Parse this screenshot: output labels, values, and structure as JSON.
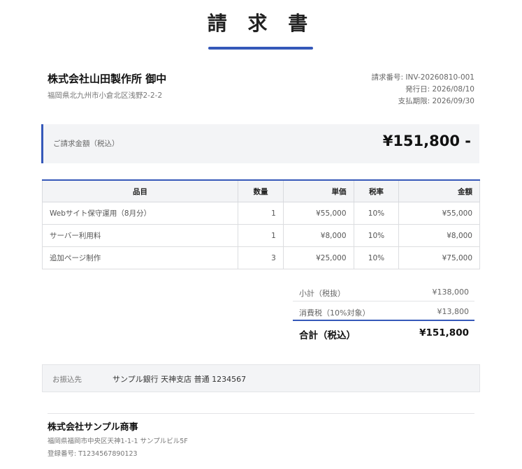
{
  "document": {
    "title": "請 求 書"
  },
  "addressee": {
    "name": "株式会社山田製作所 御中",
    "address": "福岡県北九州市小倉北区浅野2-2-2"
  },
  "meta": {
    "invoice_number": "請求番号: INV-20260810-001",
    "issue_date": "発行日: 2026/08/10",
    "due_date": "支払期限: 2026/09/30"
  },
  "banner": {
    "label": "ご請求金額（税込）",
    "amount": "¥151,800 -"
  },
  "items_table": {
    "headers": {
      "name": "品目",
      "qty": "数量",
      "unit_price": "単価",
      "tax_rate": "税率",
      "amount": "金額"
    },
    "rows": [
      {
        "name": "Webサイト保守運用（8月分）",
        "qty": "1",
        "unit_price": "¥55,000",
        "tax_rate": "10%",
        "amount": "¥55,000"
      },
      {
        "name": "サーバー利用料",
        "qty": "1",
        "unit_price": "¥8,000",
        "tax_rate": "10%",
        "amount": "¥8,000"
      },
      {
        "name": "追加ページ制作",
        "qty": "3",
        "unit_price": "¥25,000",
        "tax_rate": "10%",
        "amount": "¥75,000"
      }
    ]
  },
  "summary": {
    "subtotal_label": "小計（税抜）",
    "subtotal_value": "¥138,000",
    "tax_label": "消費税（10%対象）",
    "tax_value": "¥13,800",
    "total_label": "合計（税込）",
    "total_value": "¥151,800"
  },
  "bank": {
    "label": "お振込先",
    "value": "サンプル銀行 天神支店 普通 1234567"
  },
  "issuer": {
    "name": "株式会社サンプル商事",
    "address": "福岡県福岡市中央区天神1-1-1 サンプルビル5F",
    "registration": "登録番号: T1234567890123"
  },
  "colors": {
    "accent": "#3558b9",
    "panel": "#f3f4f6",
    "border": "#dcdde0"
  }
}
